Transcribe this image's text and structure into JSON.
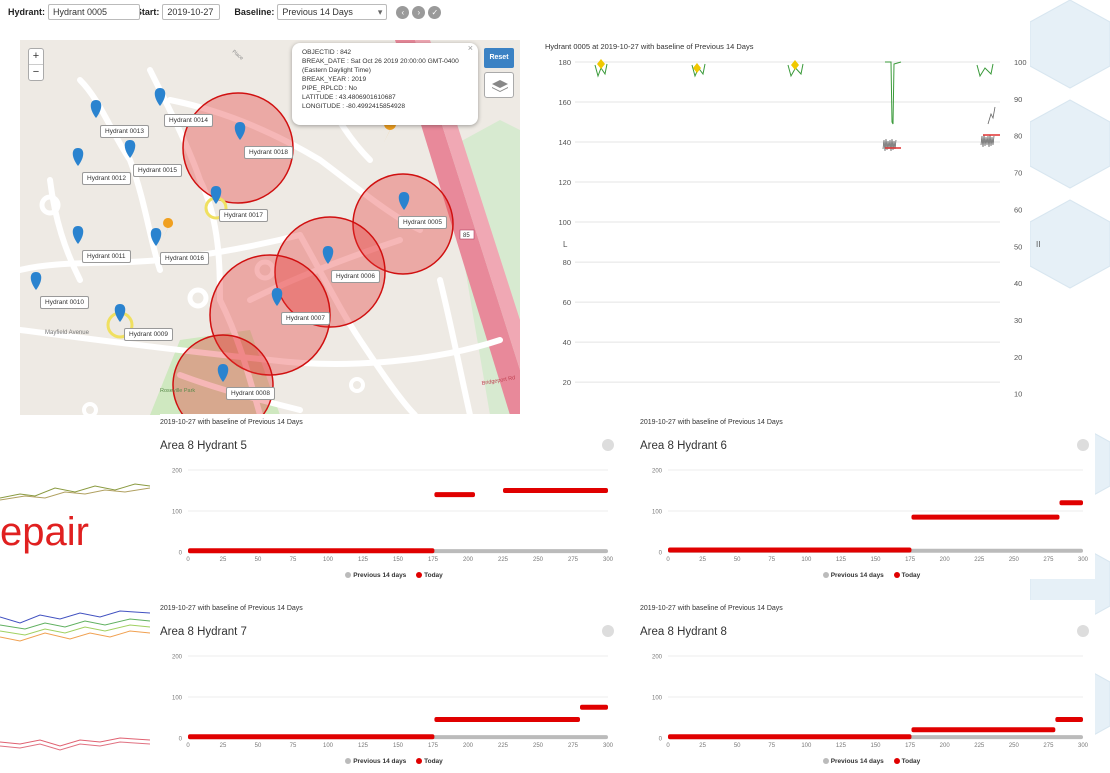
{
  "toolbar": {
    "hydrant_label": "Hydrant:",
    "hydrant_value": "Hydrant 0005",
    "clear_icon": "×",
    "dropdown_icon": "▾",
    "start_label": "Start:",
    "start_value": "2019-10-27",
    "baseline_label": "Baseline:",
    "baseline_value": "Previous 14 Days",
    "nav_icons": [
      "chevron-left-icon",
      "chevron-right-icon",
      "check-icon"
    ]
  },
  "map": {
    "zoom_in": "+",
    "zoom_out": "−",
    "reset_label": "Reset",
    "popup": {
      "close": "×",
      "lines": [
        "OBJECTID : 842",
        "BREAK_DATE : Sat Oct 26 2019 20:00:00 GMT-0400",
        "(Eastern Daylight Time)",
        "BREAK_YEAR : 2019",
        "PIPE_RPLCD : No",
        "LATITUDE : 43.4806901610687",
        "LONGITUDE : -80.4992415854928"
      ]
    },
    "hydrants": [
      "Hydrant 0013",
      "Hydrant 0014",
      "Hydrant 0018",
      "Hydrant 0012",
      "Hydrant 0015",
      "Hydrant 0017",
      "Hydrant 0005",
      "Hydrant 0011",
      "Hydrant 0016",
      "Hydrant 0006",
      "Hydrant 0010",
      "Hydrant 0007",
      "Hydrant 0009",
      "Hydrant 0008"
    ],
    "road_badge": "85",
    "street_labels": [
      "Mayfield Avenue",
      "Roseville Park",
      "Bridgeport Rd"
    ]
  },
  "timeseries": {
    "title": "Hydrant 0005 at 2019-10-27 with baseline of Previous 14 Days",
    "left_ticks": [
      "180",
      "160",
      "140",
      "120",
      "100",
      "80",
      "60",
      "40",
      "20"
    ],
    "right_ticks": [
      "100",
      "90",
      "80",
      "70",
      "60",
      "50",
      "40",
      "30",
      "20",
      "10"
    ],
    "left_axis_label": "L",
    "right_axis_label": "II",
    "colors": {
      "green": "#3a9a3a",
      "grey": "#666666",
      "red": "#e03030",
      "marker": "#f0c800"
    }
  },
  "panels": [
    {
      "caption": "2019-10-27 with baseline of Previous 14 Days",
      "title": "Area 8 Hydrant 5"
    },
    {
      "caption": "2019-10-27 with baseline of Previous 14 Days",
      "title": "Area 8 Hydrant 6"
    },
    {
      "caption": "2019-10-27 with baseline of Previous 14 Days",
      "title": "Area 8 Hydrant 7"
    },
    {
      "caption": "2019-10-27 with baseline of Previous 14 Days",
      "title": "Area 8 Hydrant 8"
    }
  ],
  "legend": {
    "baseline": "Previous 14 days",
    "today": "Today",
    "baseline_color": "#bbbbbb",
    "today_color": "#e00000"
  },
  "chart_data": [
    {
      "type": "scatter",
      "title": "Area 8 Hydrant 5",
      "x_ticks": [
        "0",
        "25",
        "50",
        "75",
        "100",
        "125",
        "150",
        "175",
        "200",
        "225",
        "250",
        "275",
        "300"
      ],
      "y_ticks": [
        "200",
        "100",
        "0"
      ],
      "ylim": [
        0,
        200
      ],
      "xlim": [
        0,
        300
      ],
      "series": [
        {
          "name": "Previous 14 days",
          "segments": [
            [
              0,
              300,
              2
            ]
          ]
        },
        {
          "name": "Today",
          "segments": [
            [
              0,
              176,
              3
            ],
            [
              176,
              205,
              140
            ],
            [
              225,
              300,
              150
            ]
          ]
        }
      ]
    },
    {
      "type": "scatter",
      "title": "Area 8 Hydrant 6",
      "x_ticks": [
        "0",
        "25",
        "50",
        "75",
        "100",
        "125",
        "150",
        "175",
        "200",
        "225",
        "250",
        "275",
        "300"
      ],
      "y_ticks": [
        "200",
        "100",
        "0"
      ],
      "ylim": [
        0,
        200
      ],
      "xlim": [
        0,
        300
      ],
      "series": [
        {
          "name": "Previous 14 days",
          "segments": [
            [
              0,
              300,
              3
            ]
          ]
        },
        {
          "name": "Today",
          "segments": [
            [
              0,
              176,
              5
            ],
            [
              176,
              283,
              85
            ],
            [
              283,
              300,
              120
            ]
          ]
        }
      ]
    },
    {
      "type": "scatter",
      "title": "Area 8 Hydrant 7",
      "x_ticks": [
        "0",
        "25",
        "50",
        "75",
        "100",
        "125",
        "150",
        "175",
        "200",
        "225",
        "250",
        "275",
        "300"
      ],
      "y_ticks": [
        "200",
        "100",
        "0"
      ],
      "ylim": [
        0,
        200
      ],
      "xlim": [
        0,
        300
      ],
      "series": [
        {
          "name": "Previous 14 days",
          "segments": [
            [
              0,
              300,
              2
            ]
          ]
        },
        {
          "name": "Today",
          "segments": [
            [
              0,
              176,
              3
            ],
            [
              176,
              280,
              45
            ],
            [
              280,
              300,
              75
            ]
          ]
        }
      ]
    },
    {
      "type": "scatter",
      "title": "Area 8 Hydrant 8",
      "x_ticks": [
        "0",
        "25",
        "50",
        "75",
        "100",
        "125",
        "150",
        "175",
        "200",
        "225",
        "250",
        "275",
        "300"
      ],
      "y_ticks": [
        "200",
        "100",
        "0"
      ],
      "ylim": [
        0,
        200
      ],
      "xlim": [
        0,
        300
      ],
      "series": [
        {
          "name": "Previous 14 days",
          "segments": [
            [
              0,
              300,
              2
            ]
          ]
        },
        {
          "name": "Today",
          "segments": [
            [
              0,
              176,
              3
            ],
            [
              176,
              280,
              20
            ],
            [
              280,
              300,
              45
            ]
          ]
        }
      ]
    }
  ],
  "background_text": "epair"
}
